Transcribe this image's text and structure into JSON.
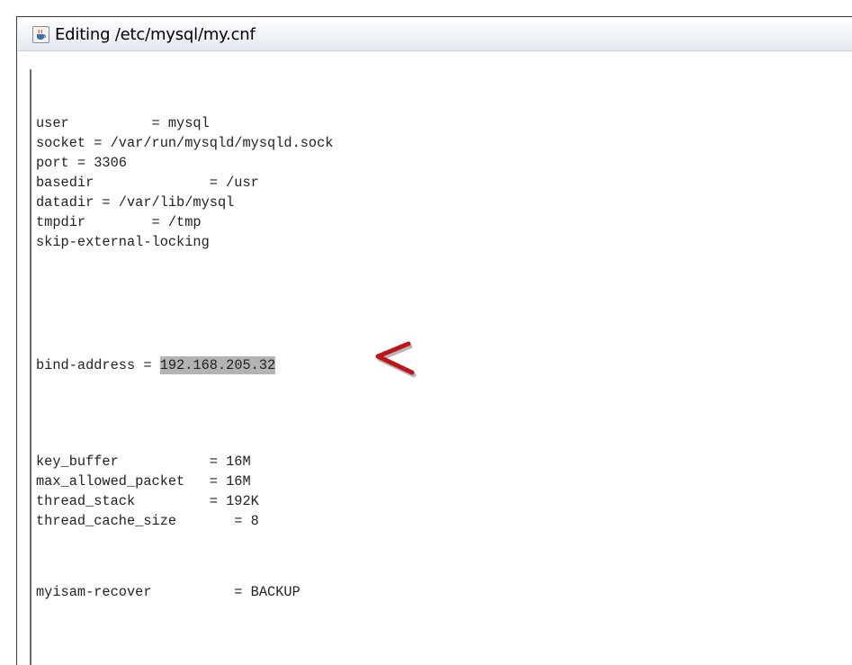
{
  "window": {
    "title": "Editing /etc/mysql/my.cnf",
    "icon": "java-coffee-cup-icon"
  },
  "editor": {
    "lines": [
      "user          = mysql",
      "socket = /var/run/mysqld/mysqld.sock",
      "port = 3306",
      "basedir              = /usr",
      "datadir = /var/lib/mysql",
      "tmpdir        = /tmp",
      "skip-external-locking",
      "bind-address = ",
      "key_buffer           = 16M",
      "max_allowed_packet   = 16M",
      "thread_stack         = 192K",
      "thread_cache_size       = 8",
      "myisam-recover          = BACKUP"
    ],
    "selected_text": "192.168.205.32"
  },
  "annotation": {
    "arrow_color": "#c0141b"
  }
}
